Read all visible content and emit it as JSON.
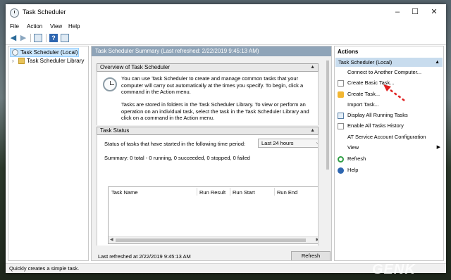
{
  "window": {
    "title": "Task Scheduler",
    "controls": [
      "–",
      "☐",
      "✕"
    ]
  },
  "menu": [
    "File",
    "Action",
    "View",
    "Help"
  ],
  "tree": {
    "root": "Task Scheduler (Local)",
    "library": "Task Scheduler Library"
  },
  "center": {
    "header": "Task Scheduler Summary (Last refreshed: 2/22/2019 9:45:13 AM)",
    "overview_title": "Overview of Task Scheduler",
    "overview_p1": "You can use Task Scheduler to create and manage common tasks that your computer will carry out automatically at the times you specify. To begin, click a command in the Action menu.",
    "overview_p2": "Tasks are stored in folders in the Task Scheduler Library. To view or perform an operation on an individual task, select the task in the Task Scheduler Library and click on a command in the Action menu.",
    "status_title": "Task Status",
    "status_label": "Status of tasks that have started in the following time period:",
    "period_value": "Last 24 hours",
    "summary": "Summary: 0 total - 0 running, 0 succeeded, 0 stopped, 0 failed",
    "columns": [
      "Task Name",
      "Run Result",
      "Run Start",
      "Run End"
    ],
    "footer": "Last refreshed at 2/22/2019 9:45:13 AM",
    "refresh_btn": "Refresh"
  },
  "actions": {
    "title": "Actions",
    "group": "Task Scheduler (Local)",
    "items": [
      {
        "label": "Connect to Another Computer...",
        "icon": "none"
      },
      {
        "label": "Create Basic Task...",
        "icon": "create-basic-task-icon"
      },
      {
        "label": "Create Task...",
        "icon": "create-task-icon"
      },
      {
        "label": "Import Task...",
        "icon": "none"
      },
      {
        "label": "Display All Running Tasks",
        "icon": "list-icon"
      },
      {
        "label": "Enable All Tasks History",
        "icon": "history-icon"
      },
      {
        "label": "AT Service Account Configuration",
        "icon": "none"
      },
      {
        "label": "View",
        "icon": "none"
      },
      {
        "label": "Refresh",
        "icon": "refresh-icon"
      },
      {
        "label": "Help",
        "icon": "help-icon"
      }
    ]
  },
  "statusbar": "Quickly creates a simple task.",
  "watermark": "GENK",
  "colors": {
    "accent": "#cce8ff",
    "header": "#8fa4b8",
    "arrow": "#e02020"
  }
}
